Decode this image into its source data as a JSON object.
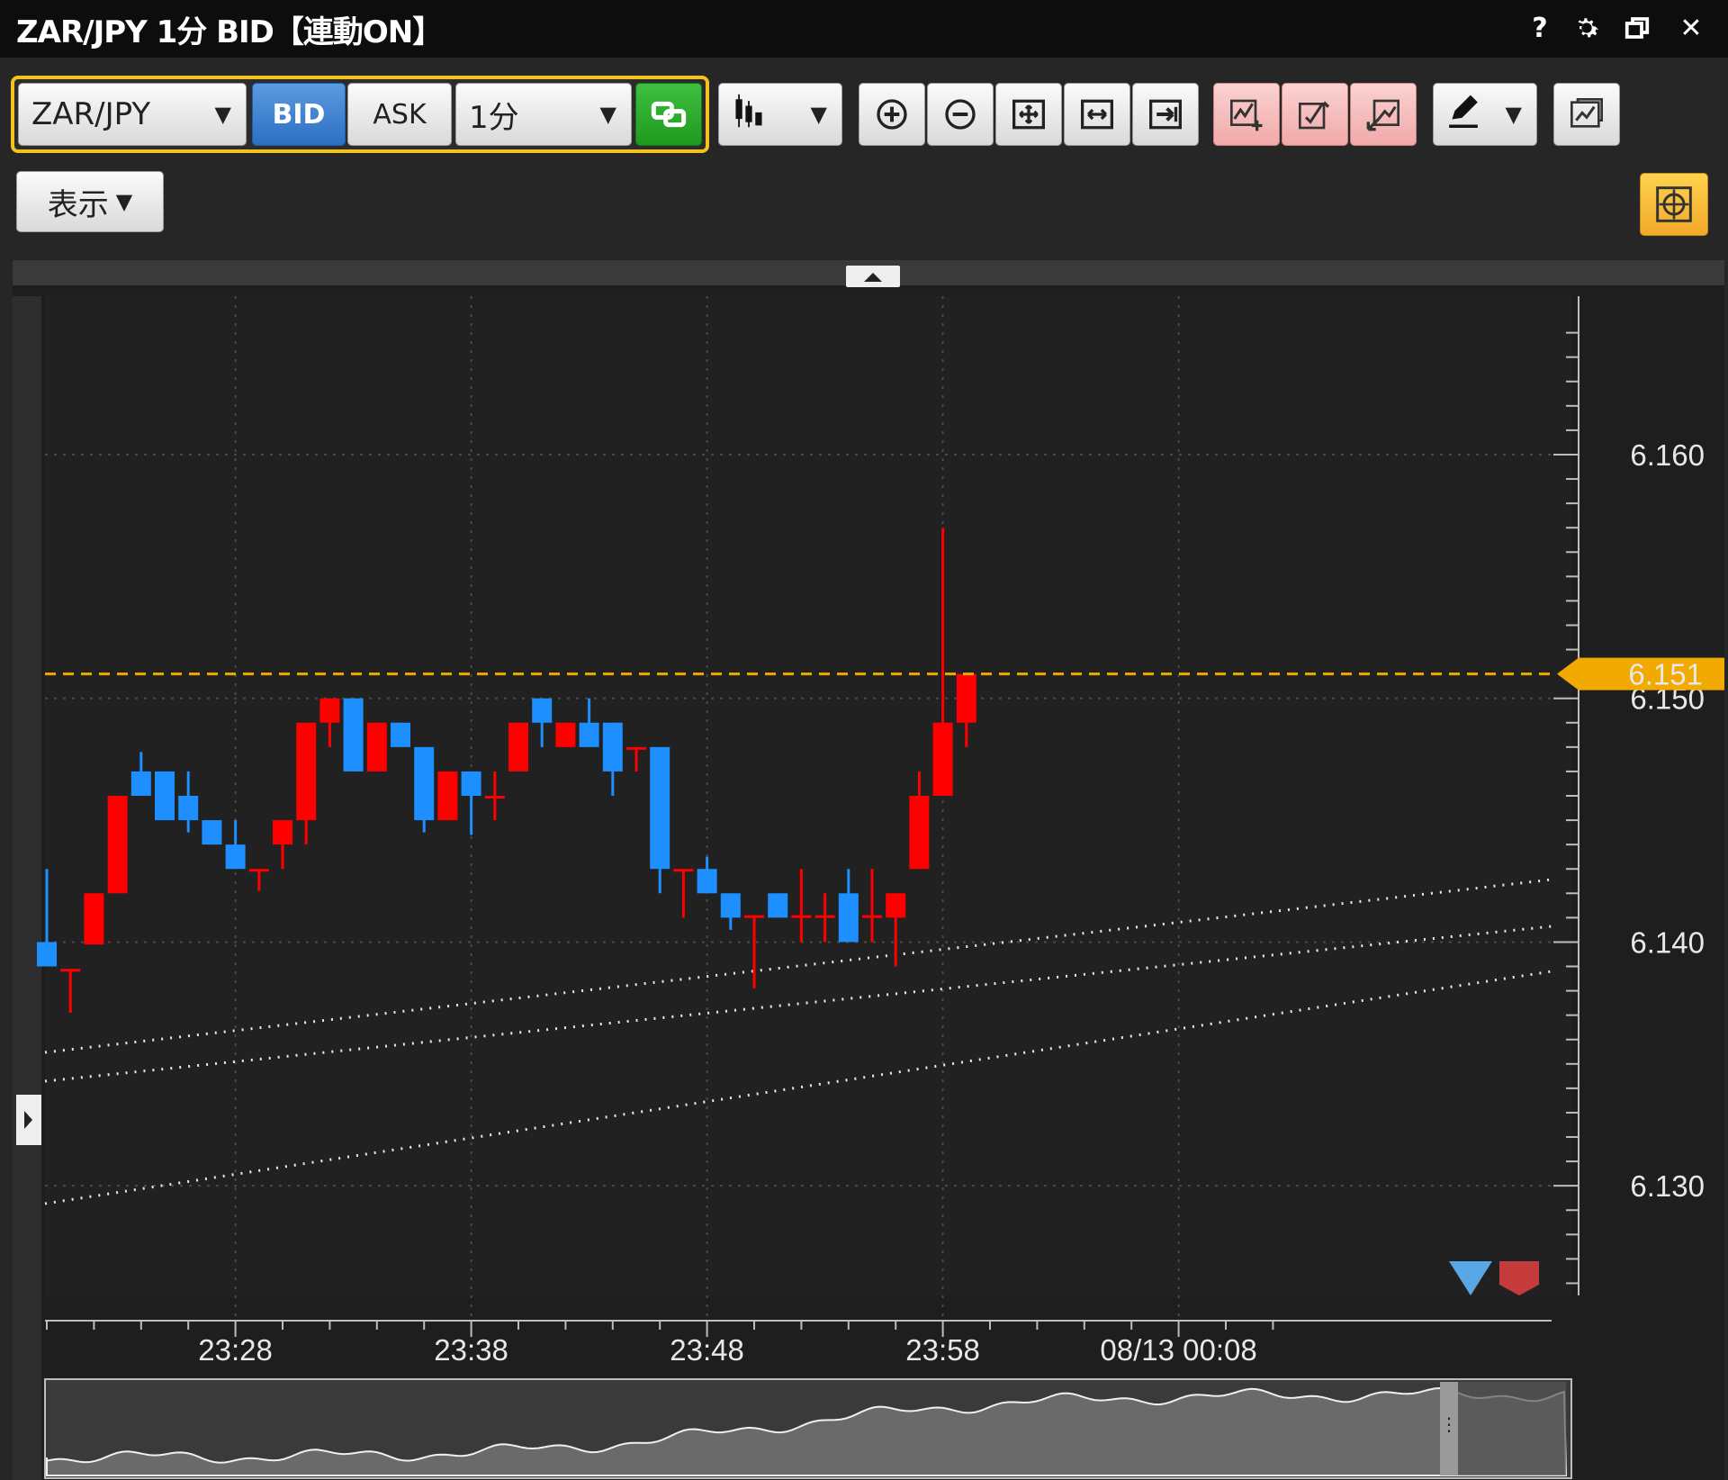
{
  "window": {
    "title": "ZAR/JPY 1分 BID【連動ON】",
    "help_label": "?",
    "settings_icon": "gear-icon",
    "restore_icon": "restore-window-icon",
    "close_label": "✕"
  },
  "toolbar": {
    "symbol": "ZAR/JPY",
    "bid_label": "BID",
    "ask_label": "ASK",
    "interval": "1分",
    "link_icon": "link-windows-icon",
    "chart_type_icon": "candlestick-icon",
    "zoom_in_icon": "zoom-in-icon",
    "zoom_out_icon": "zoom-out-icon",
    "fit_icon": "fit-chart-icon",
    "expand_icon": "expand-width-icon",
    "latest_icon": "jump-to-latest-icon",
    "indicator_add_icon": "indicator-add-icon",
    "indicator_edit_icon": "indicator-edit-icon",
    "indicator_move_icon": "indicator-move-icon",
    "draw_icon": "pen-draw-icon",
    "compare_icon": "compare-chart-icon",
    "display_label": "表示",
    "target_icon": "crosshair-icon",
    "accent_yellow": "#f2c21f",
    "bid_color": "#2b6fc4",
    "green_color": "#1f9a1f"
  },
  "chart_data": {
    "type": "candlestick",
    "symbol": "ZAR/JPY",
    "y_ticks": [
      "6.160",
      "6.150",
      "6.140",
      "6.130"
    ],
    "x_ticks": [
      "23:28",
      "23:38",
      "23:48",
      "23:58",
      "08/13 00:08"
    ],
    "current_price": "6.151",
    "ylim": [
      6.1255,
      6.1665
    ],
    "up_color": "#ff0000",
    "down_color": "#1e8fff",
    "price_line_color": "#f2a900",
    "candles": [
      {
        "time": "23:20",
        "o": 6.14,
        "h": 6.143,
        "l": 6.139,
        "c": 6.139
      },
      {
        "time": "23:21",
        "o": 6.1389,
        "h": 6.1389,
        "l": 6.1371,
        "c": 6.1389
      },
      {
        "time": "23:22",
        "o": 6.1399,
        "h": 6.142,
        "l": 6.1399,
        "c": 6.142
      },
      {
        "time": "23:23",
        "o": 6.142,
        "h": 6.146,
        "l": 6.142,
        "c": 6.146
      },
      {
        "time": "23:24",
        "o": 6.147,
        "h": 6.1478,
        "l": 6.146,
        "c": 6.146
      },
      {
        "time": "23:25",
        "o": 6.147,
        "h": 6.147,
        "l": 6.145,
        "c": 6.145
      },
      {
        "time": "23:26",
        "o": 6.146,
        "h": 6.147,
        "l": 6.1445,
        "c": 6.145
      },
      {
        "time": "23:27",
        "o": 6.145,
        "h": 6.145,
        "l": 6.144,
        "c": 6.144
      },
      {
        "time": "23:28",
        "o": 6.144,
        "h": 6.145,
        "l": 6.143,
        "c": 6.143
      },
      {
        "time": "23:29",
        "o": 6.143,
        "h": 6.143,
        "l": 6.1421,
        "c": 6.143
      },
      {
        "time": "23:30",
        "o": 6.144,
        "h": 6.144,
        "l": 6.143,
        "c": 6.145
      },
      {
        "time": "23:31",
        "o": 6.145,
        "h": 6.147,
        "l": 6.144,
        "c": 6.149
      },
      {
        "time": "23:32",
        "o": 6.149,
        "h": 6.15,
        "l": 6.148,
        "c": 6.15
      },
      {
        "time": "23:33",
        "o": 6.15,
        "h": 6.15,
        "l": 6.147,
        "c": 6.147
      },
      {
        "time": "23:34",
        "o": 6.147,
        "h": 6.149,
        "l": 6.147,
        "c": 6.149
      },
      {
        "time": "23:35",
        "o": 6.149,
        "h": 6.149,
        "l": 6.148,
        "c": 6.148
      },
      {
        "time": "23:36",
        "o": 6.148,
        "h": 6.148,
        "l": 6.1445,
        "c": 6.145
      },
      {
        "time": "23:37",
        "o": 6.145,
        "h": 6.147,
        "l": 6.145,
        "c": 6.147
      },
      {
        "time": "23:38",
        "o": 6.147,
        "h": 6.147,
        "l": 6.1444,
        "c": 6.146
      },
      {
        "time": "23:39",
        "o": 6.146,
        "h": 6.147,
        "l": 6.145,
        "c": 6.146
      },
      {
        "time": "23:40",
        "o": 6.147,
        "h": 6.149,
        "l": 6.147,
        "c": 6.149
      },
      {
        "time": "23:41",
        "o": 6.15,
        "h": 6.15,
        "l": 6.148,
        "c": 6.149
      },
      {
        "time": "23:42",
        "o": 6.148,
        "h": 6.149,
        "l": 6.148,
        "c": 6.149
      },
      {
        "time": "23:43",
        "o": 6.149,
        "h": 6.15,
        "l": 6.148,
        "c": 6.148
      },
      {
        "time": "23:44",
        "o": 6.149,
        "h": 6.149,
        "l": 6.146,
        "c": 6.147
      },
      {
        "time": "23:45",
        "o": 6.148,
        "h": 6.148,
        "l": 6.147,
        "c": 6.148
      },
      {
        "time": "23:46",
        "o": 6.148,
        "h": 6.148,
        "l": 6.142,
        "c": 6.143
      },
      {
        "time": "23:47",
        "o": 6.143,
        "h": 6.143,
        "l": 6.141,
        "c": 6.143
      },
      {
        "time": "23:48",
        "o": 6.143,
        "h": 6.1435,
        "l": 6.142,
        "c": 6.142
      },
      {
        "time": "23:49",
        "o": 6.142,
        "h": 6.142,
        "l": 6.1405,
        "c": 6.141
      },
      {
        "time": "23:50",
        "o": 6.1411,
        "h": 6.1411,
        "l": 6.1381,
        "c": 6.1411
      },
      {
        "time": "23:51",
        "o": 6.142,
        "h": 6.142,
        "l": 6.141,
        "c": 6.141
      },
      {
        "time": "23:52",
        "o": 6.1411,
        "h": 6.143,
        "l": 6.14,
        "c": 6.1411
      },
      {
        "time": "23:53",
        "o": 6.1411,
        "h": 6.142,
        "l": 6.14,
        "c": 6.1411
      },
      {
        "time": "23:54",
        "o": 6.142,
        "h": 6.143,
        "l": 6.14,
        "c": 6.14
      },
      {
        "time": "23:55",
        "o": 6.1411,
        "h": 6.143,
        "l": 6.14,
        "c": 6.1411
      },
      {
        "time": "23:56",
        "o": 6.141,
        "h": 6.142,
        "l": 6.139,
        "c": 6.142
      },
      {
        "time": "23:57",
        "o": 6.143,
        "h": 6.147,
        "l": 6.143,
        "c": 6.146
      },
      {
        "time": "23:58",
        "o": 6.146,
        "h": 6.157,
        "l": 6.146,
        "c": 6.149
      },
      {
        "time": "23:59",
        "o": 6.149,
        "h": 6.151,
        "l": 6.148,
        "c": 6.151
      }
    ]
  }
}
